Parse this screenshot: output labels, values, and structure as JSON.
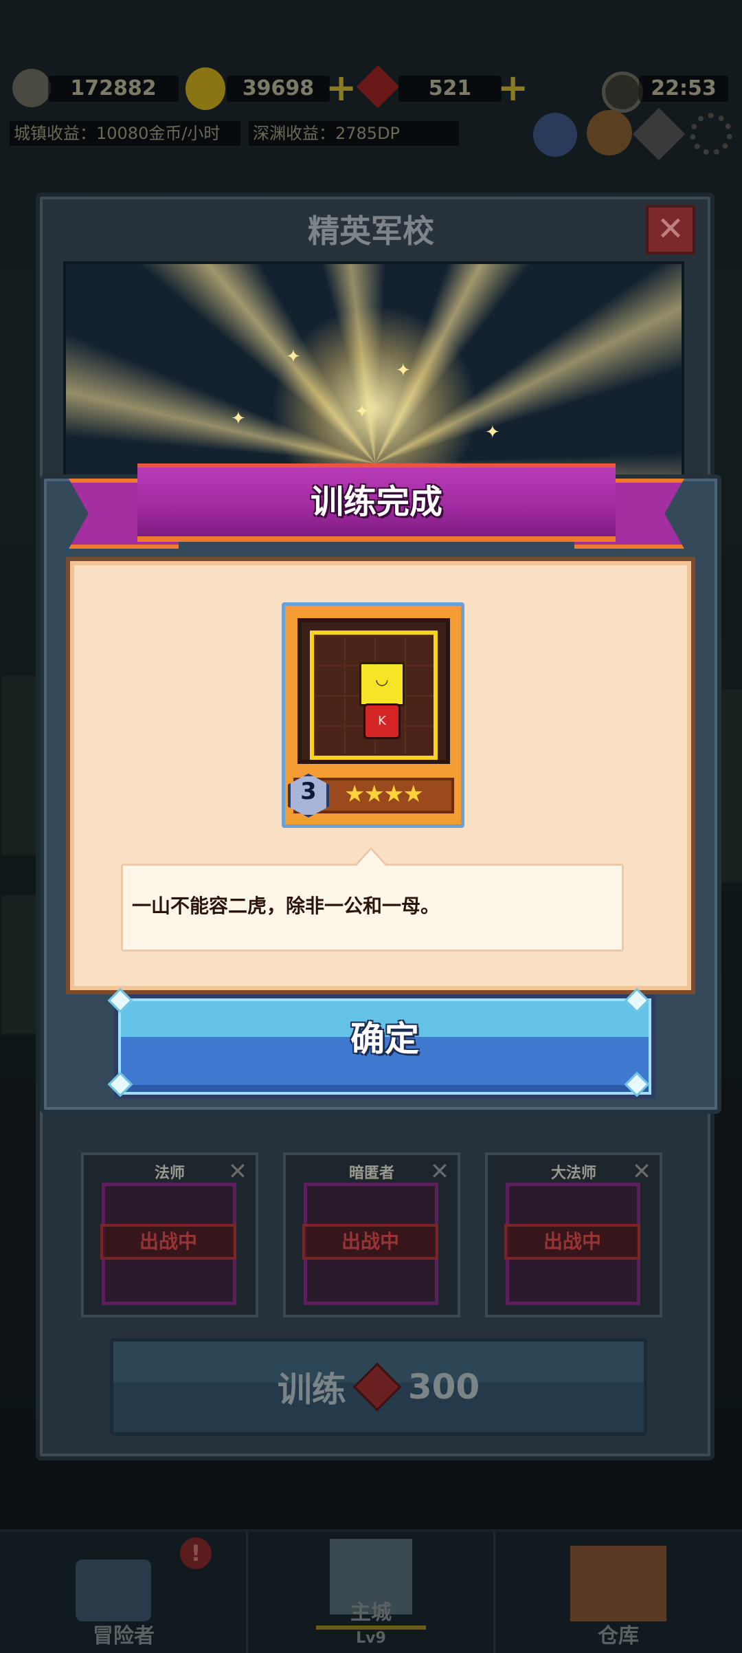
{
  "hud": {
    "power": "172882",
    "gold": "39698",
    "gems": "521",
    "clock": "22:53",
    "town_income": "城镇收益：10080金币/小时",
    "abyss_income": "深渊收益：2785DP",
    "icons": [
      "sword-icon",
      "coin-icon",
      "gem-icon",
      "plus-icon",
      "clock-icon",
      "party-icon",
      "pet-icon",
      "compass-icon",
      "settings-icon"
    ]
  },
  "academy": {
    "title": "精英军校",
    "close_glyph": "✕",
    "units": [
      {
        "name": "法师",
        "status": "出战中"
      },
      {
        "name": "暗匿者",
        "status": "出战中"
      },
      {
        "name": "大法师",
        "status": "出战中"
      }
    ],
    "train_label": "训练",
    "train_cost": "300"
  },
  "nav": {
    "items": [
      {
        "label": "冒险者"
      },
      {
        "label": "主城"
      },
      {
        "label": "仓库"
      }
    ],
    "city_level": "Lv9",
    "notice": "!"
  },
  "modal": {
    "title": "训练完成",
    "card": {
      "level": "3",
      "stars": 4,
      "stars_text": "★★★★",
      "emblem": "K",
      "face": "◡"
    },
    "quote": "一山不能容二虎，除非一公和一母。",
    "confirm_label": "确定"
  },
  "colors": {
    "ribbon": "#a02aa0",
    "ribbon_edge": "#f07a2c",
    "confirm_top": "#63c2e6",
    "confirm_bottom": "#3f7ad0",
    "card_orange": "#f39c34",
    "content_bg": "#f9dfc3"
  }
}
